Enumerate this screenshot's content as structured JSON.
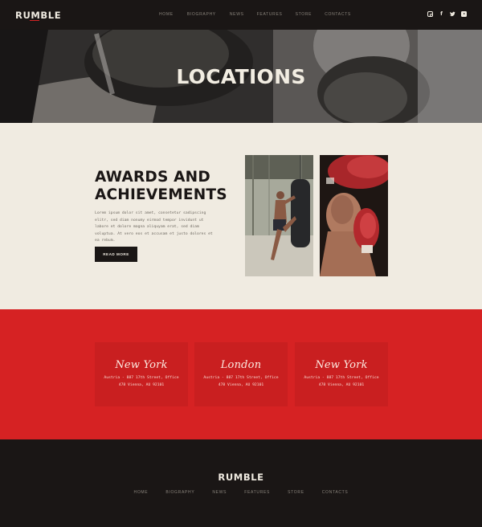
{
  "header": {
    "logo": "RUMBLE",
    "nav": [
      "HOME",
      "BIOGRAPHY",
      "NEWS",
      "FEATURES",
      "STORE",
      "CONTACTS"
    ],
    "social_icons": [
      "instagram-icon",
      "facebook-icon",
      "twitter-icon",
      "youtube-icon"
    ]
  },
  "hero": {
    "title": "LOCATIONS"
  },
  "awards": {
    "title_line1": "AWARDS AND",
    "title_line2": "ACHIEVEMENTS",
    "body": "Lorem ipsum dolor sit amet, consetetur sadipscing elitr, sed diam nonumy eirmod tempor invidunt ut labore et dolore magna aliquyam erat, sed diam voluptua. At vero eos et accusam et justo dolores et ea rebum.",
    "button": "READ MORE"
  },
  "locations": [
    {
      "city": "New York",
      "address": "Austria - 887 17th Street, Office 478 Vienna, AU 92101"
    },
    {
      "city": "London",
      "address": "Austria - 887 17th Street, Office 478 Vienna, AU 92101"
    },
    {
      "city": "New York",
      "address": "Austria - 887 17th Street, Office 478 Vienna, AU 92101"
    }
  ],
  "footer": {
    "logo": "RUMBLE",
    "nav": [
      "HOME",
      "BIOGRAPHY",
      "NEWS",
      "FEATURES",
      "STORE",
      "CONTACTS"
    ]
  },
  "colors": {
    "accent": "#d62223",
    "dark": "#1a1615",
    "cream": "#f0ebe1"
  }
}
